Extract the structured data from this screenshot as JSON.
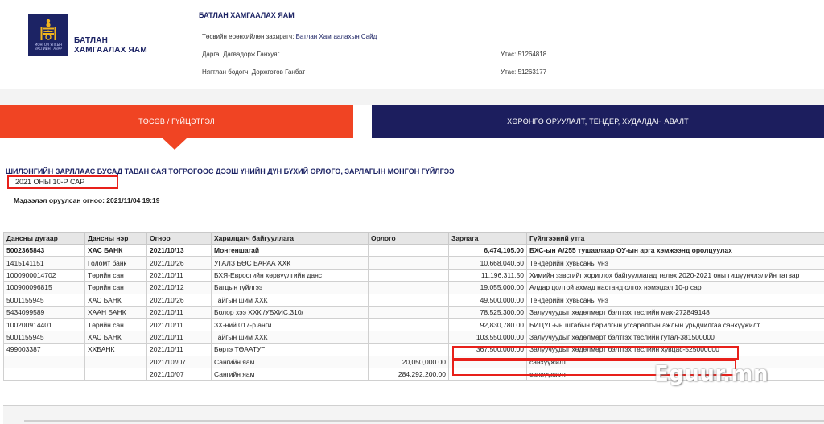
{
  "header": {
    "logo_text_line1": "БАТЛАН",
    "logo_text_line2": "ХАМГААЛАХ ЯАМ",
    "logo_mini_line1": "МОНГОЛ УЛСЫН",
    "logo_mini_line2": "ЗАСГИЙН ГАЗАР",
    "ministry_title": "БАТЛАН ХАМГААЛАХ ЯАМ",
    "manager_label": "Төсвийн ерөнхийлөн захирагч:",
    "manager_value": "Батлан Хамгаалахын Сайд",
    "head_label": "Дарга:",
    "head_value": "Дагвадорж Ганхуяг",
    "accountant_label": "Нягтлан бодогч:",
    "accountant_value": "Доржготов Ганбат",
    "phone_label": "Утас:",
    "phone1": "51264818",
    "phone2": "51263177"
  },
  "tabs": [
    {
      "label": "ТӨСӨВ / ГҮЙЦЭТГЭЛ",
      "active": true
    },
    {
      "label": "ХӨРӨНГӨ ОРУУЛАЛТ, ТЕНДЕР, ХУДАЛДАН АВАЛТ",
      "active": false
    }
  ],
  "report": {
    "title": "ШИЛЭНГИЙН ЗАРЛЛААС БУСАД ТАВАН САЯ ТӨГРӨГӨӨС ДЭЭШ ҮНИЙН ДҮН БҮХИЙ ОРЛОГО, ЗАРЛАГЫН МӨНГӨН ГҮЙЛГЭЭ",
    "period": "2021 ОНЫ 10-Р САР",
    "updated_label": "Мэдээлэл оруулсан огноо:",
    "updated_value": "2021/11/04 19:19"
  },
  "table": {
    "columns": [
      "Дансны дугаар",
      "Дансны нэр",
      "Огноо",
      "Харилцагч байгууллага",
      "Орлого",
      "Зарлага",
      "Гүйлгээний утга"
    ],
    "rows": [
      [
        "5002365843",
        "ХАС БАНК",
        "2021/10/13",
        "Монгеншагай",
        "",
        "6,474,105.00",
        "БХС-ын А/255 тушаалаар ОУ-ын арга хэмжээнд оролцуулах"
      ],
      [
        "1415141151",
        "Голомт банк",
        "2021/10/26",
        "УГАЛЗ БӨС БАРАА ХХК",
        "",
        "10,668,040.60",
        "Тендерийн хувьсаны үнэ"
      ],
      [
        "1000900014702",
        "Төрийн сан",
        "2021/10/11",
        "БХЯ-Евроогийн хөрвүүлгийн данс",
        "",
        "11,196,311.50",
        "Химийн зэвсгийг хориглох байгууллагад төлөх 2020-2021 оны гишүүнчлэлийн татвар"
      ],
      [
        "100900096815",
        "Төрийн сан",
        "2021/10/12",
        "Багцын гүйлгээ",
        "",
        "19,055,000.00",
        "Алдар цолтой ахмад настанд олгох нэмэгдэл 10-р сар"
      ],
      [
        "5001155945",
        "ХАС БАНК",
        "2021/10/26",
        "Тайгын шим ХХК",
        "",
        "49,500,000.00",
        "Тендерийн хувьсаны үнэ"
      ],
      [
        "5434099589",
        "ХААН БАНК",
        "2021/10/11",
        "Болор хээ ХХК /УБХИС,310/",
        "",
        "78,525,300.00",
        "Залуучуудыг хөдөлмөрт бэлтгэх төслийн мах-272849148"
      ],
      [
        "100200914401",
        "Төрийн сан",
        "2021/10/11",
        "ЗХ-ний 017-р анги",
        "",
        "92,830,780.00",
        "БИЦУГ-ын штабын барилгын угсаралтын ажлын урьдчилгаа санхүүжилт"
      ],
      [
        "5001155945",
        "ХАС БАНК",
        "2021/10/11",
        "Тайгын шим ХХК",
        "",
        "103,550,000.00",
        "Залуучуудыг хөдөлмөрт бэлтгэх төслийн гутал-381500000"
      ],
      [
        "499003387",
        "ХХБАНК",
        "2021/10/11",
        "Бөртэ ТӨААТУГ",
        "",
        "367,500,000.00",
        "Залуучуудыг хөдөлмөрт бэлтгэх төслийн хувцас-525000000"
      ],
      [
        "",
        "",
        "2021/10//07",
        "Сангийн яам",
        "20,050,000.00",
        "",
        "санхүүжилт"
      ],
      [
        "",
        "",
        "2021/10/07",
        "Сангийн яам",
        "284,292,200.00",
        "",
        "санхүүжилт"
      ]
    ]
  },
  "watermark": "Eguur.mn",
  "colors": {
    "navy": "#1c2364",
    "accent": "#f04423",
    "highlight": "#e8201a"
  }
}
